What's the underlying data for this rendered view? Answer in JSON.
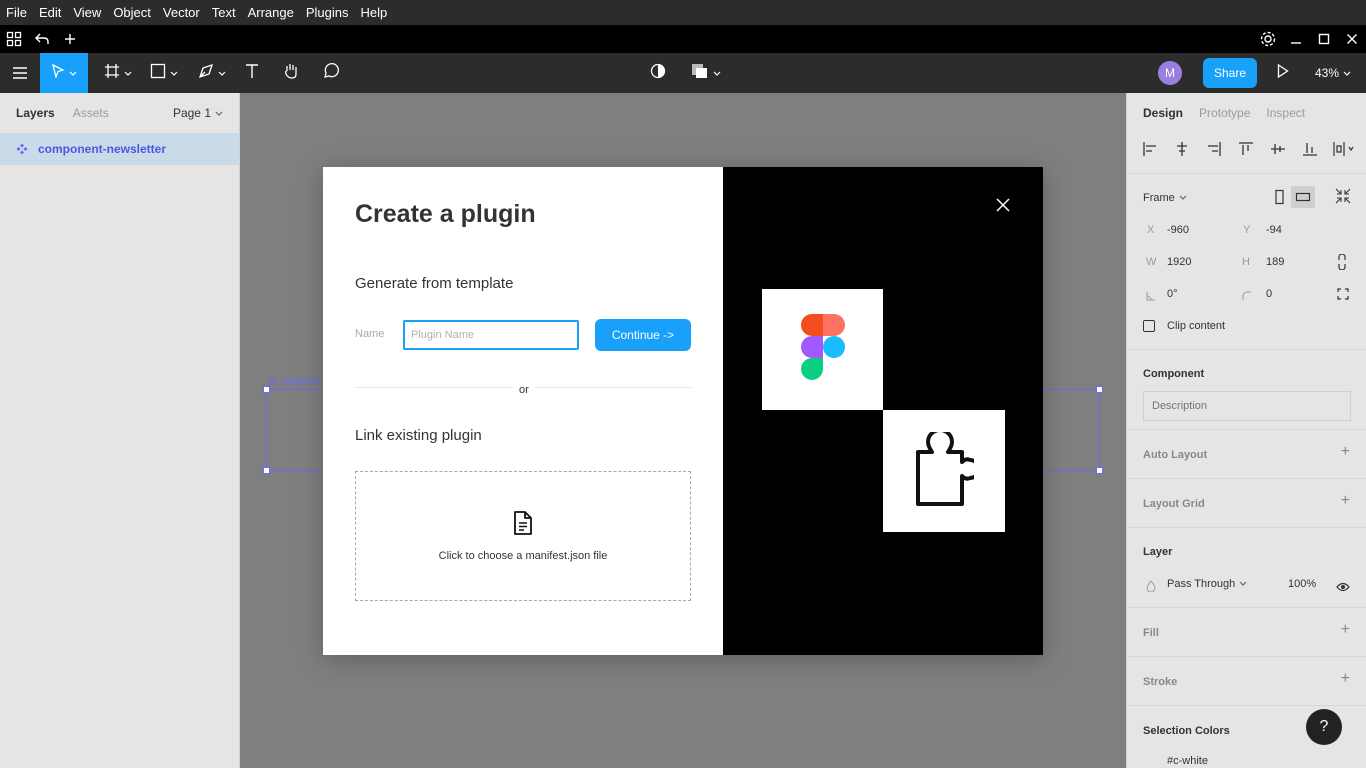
{
  "menu": {
    "items": [
      "File",
      "Edit",
      "View",
      "Object",
      "Vector",
      "Text",
      "Arrange",
      "Plugins",
      "Help"
    ]
  },
  "toolbar": {
    "icons": [
      "hamburger-icon",
      "move-icon",
      "frame-icon",
      "rectangle-icon",
      "pen-icon",
      "text-icon",
      "hand-icon",
      "comment-icon",
      "contrast-icon",
      "component-icon",
      "play-icon"
    ],
    "avatar_letter": "M",
    "share_label": "Share",
    "zoom": "43%"
  },
  "left_panel": {
    "tabs": {
      "layers": "Layers",
      "assets": "Assets"
    },
    "page": "Page 1",
    "layer_name": "component-newsletter"
  },
  "canvas": {
    "frame_label": "compon"
  },
  "modal": {
    "title": "Create a plugin",
    "generate_heading": "Generate from template",
    "name_label": "Name",
    "name_placeholder": "Plugin Name",
    "continue_label": "Continue ->",
    "or_text": "or",
    "link_heading": "Link existing plugin",
    "manifest_text": "Click to choose a manifest.json file"
  },
  "right_panel": {
    "tabs": {
      "design": "Design",
      "prototype": "Prototype",
      "inspect": "Inspect"
    },
    "frame_label": "Frame",
    "x_label": "X",
    "x_value": "-960",
    "y_label": "Y",
    "y_value": "-94",
    "w_label": "W",
    "w_value": "1920",
    "h_label": "H",
    "h_value": "189",
    "rotation": "0°",
    "radius": "0",
    "clip_content": "Clip content",
    "component_title": "Component",
    "description_placeholder": "Description",
    "auto_layout": "Auto Layout",
    "layout_grid": "Layout Grid",
    "layer_title": "Layer",
    "blend_mode": "Pass Through",
    "opacity": "100%",
    "fill_title": "Fill",
    "stroke_title": "Stroke",
    "selection_colors_title": "Selection Colors",
    "selection_color_1": "#c-white"
  },
  "help": {
    "label": "?"
  },
  "colors": {
    "accent": "#18a0fb",
    "selection": "#6b68f5",
    "dark": "#2c2c2c",
    "canvas": "#7f7f7f"
  }
}
